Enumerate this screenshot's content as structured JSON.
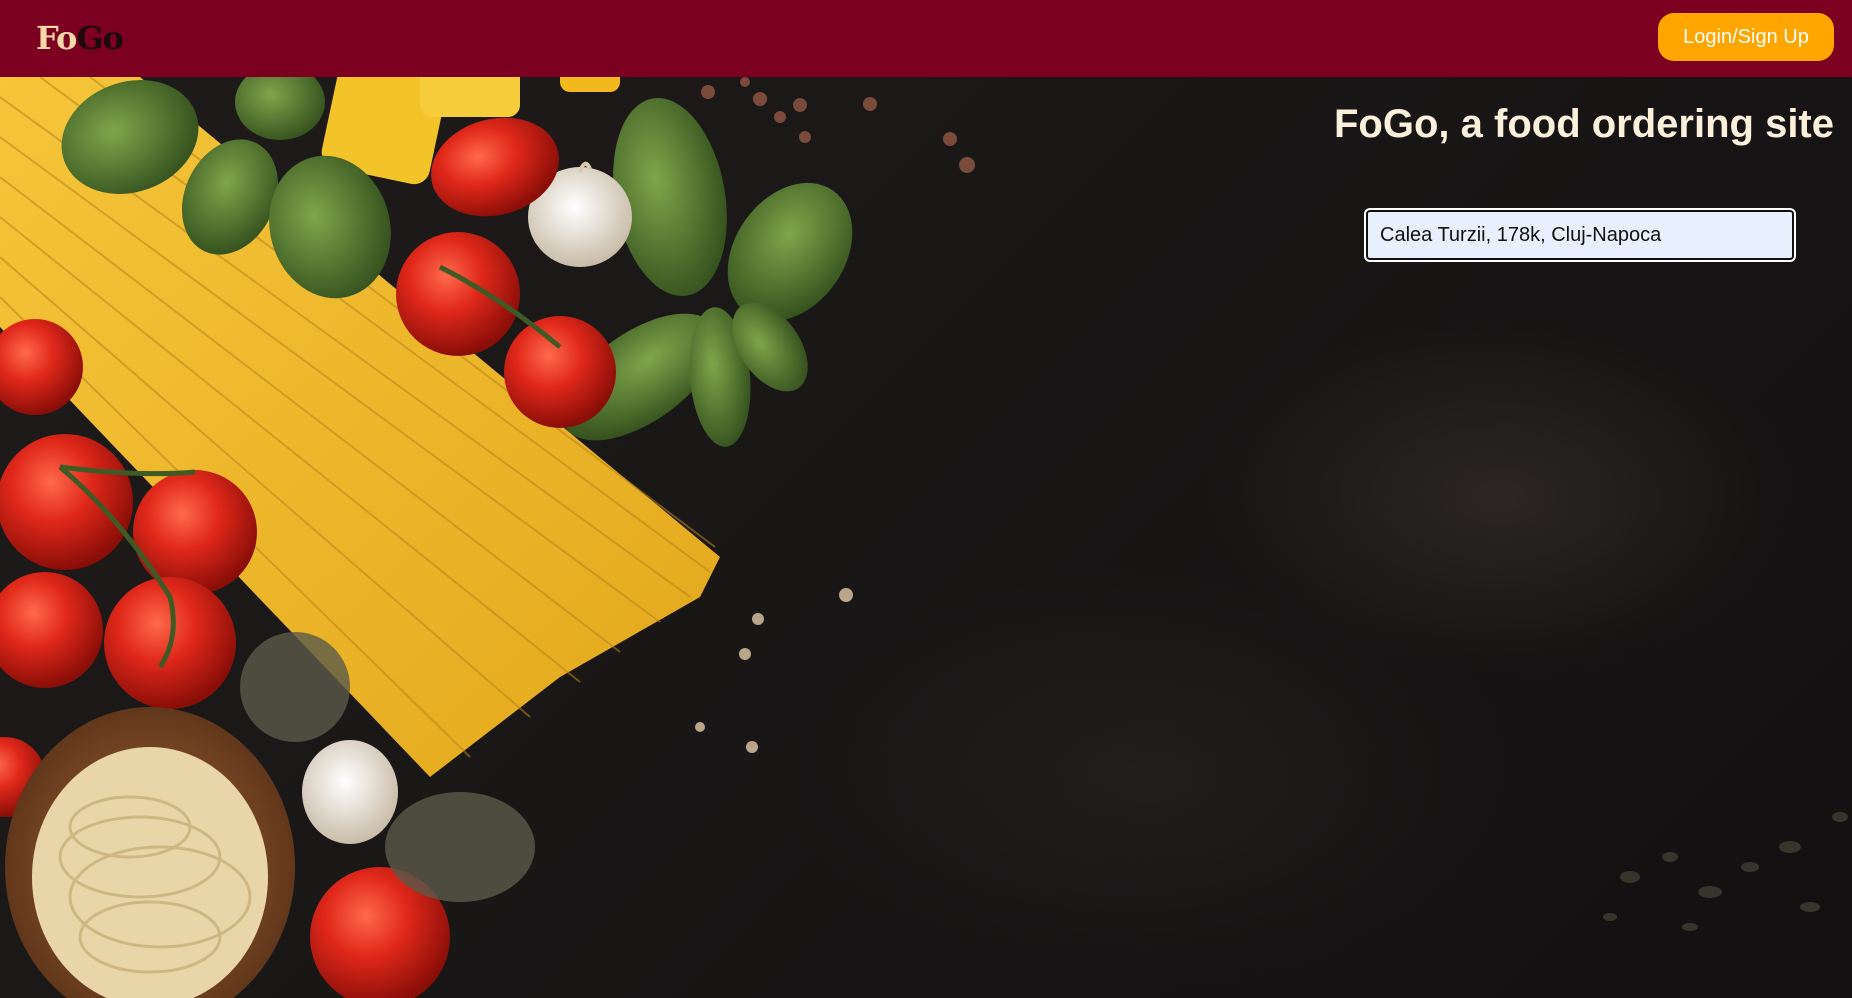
{
  "header": {
    "logo_part1": "Fo",
    "logo_part2": "Go",
    "login_label": "Login/Sign Up"
  },
  "hero": {
    "title": "FoGo, a food ordering site",
    "address_value": "Calea Turzii, 178k, Cluj-Napoca"
  },
  "colors": {
    "header_bg": "#7c0020",
    "button_bg": "#ffa500",
    "title_text": "#fbf0dc"
  },
  "background_image": "pasta, tomatoes, basil, garlic and spices on dark slate"
}
